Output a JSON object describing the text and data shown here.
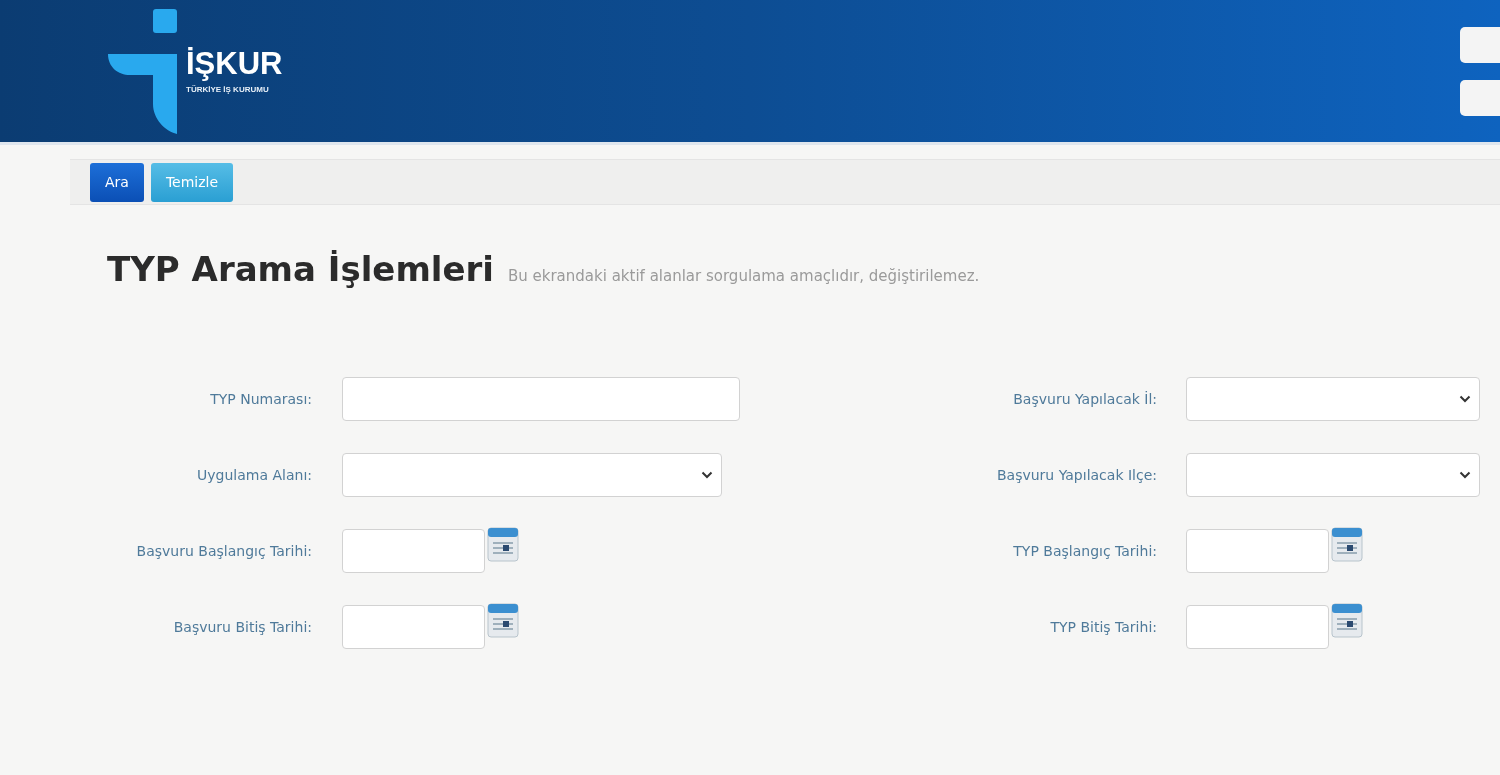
{
  "header": {
    "logo_title": "İŞKUR",
    "logo_subtitle": "TÜRKİYE İŞ KURUMU"
  },
  "toolbar": {
    "buttons": [
      {
        "label": "Ara",
        "kind": "primary"
      },
      {
        "label": "Temizle",
        "kind": "secondary"
      }
    ]
  },
  "page": {
    "title": "TYP Arama İşlemleri",
    "subtitle": "Bu ekrandaki aktif alanlar sorgulama amaçlıdır, değiştirilemez."
  },
  "form": {
    "left": [
      {
        "label": "TYP Numarası:",
        "kind": "text"
      },
      {
        "label": "Uygulama Alanı:",
        "kind": "select"
      },
      {
        "label": "Başvuru Başlangıç Tarihi:",
        "kind": "date"
      },
      {
        "label": "Başvuru Bitiş Tarihi:",
        "kind": "date"
      }
    ],
    "right": [
      {
        "label": "Başvuru Yapılacak İl:",
        "kind": "select"
      },
      {
        "label": "Başvuru Yapılacak Ilçe:",
        "kind": "select"
      },
      {
        "label": "TYP Başlangıç Tarihi:",
        "kind": "date"
      },
      {
        "label": "TYP Bitiş Tarihi:",
        "kind": "date"
      }
    ]
  }
}
